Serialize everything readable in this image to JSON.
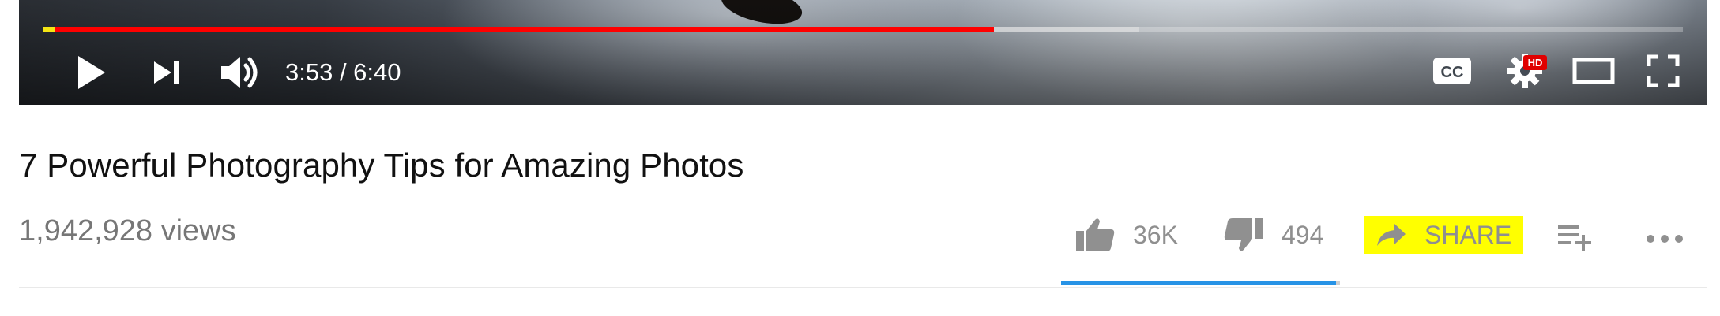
{
  "player": {
    "progress": {
      "played_fraction": 0.58,
      "buffered_fraction": 0.668
    },
    "time_display": "3:53 / 6:40",
    "settings_badge": "HD",
    "icons": {
      "play": "play-icon",
      "next": "skip-next-icon",
      "volume": "volume-icon",
      "captions": "closed-captions-icon",
      "settings": "gear-icon",
      "theater": "theater-mode-icon",
      "fullscreen": "fullscreen-icon"
    },
    "colors": {
      "played": "#ff0000",
      "chapter_marker": "#f4e514"
    }
  },
  "video": {
    "title": "7 Powerful Photography Tips for Amazing Photos",
    "views": "1,942,928 views"
  },
  "actions": {
    "likes": "36K",
    "dislikes": "494",
    "share": "SHARE",
    "icons": {
      "like": "thumbs-up-icon",
      "dislike": "thumbs-down-icon",
      "share": "share-arrow-icon",
      "add_to": "add-to-playlist-icon",
      "more": "more-horizontal-icon"
    },
    "sentiment_like_fraction": 0.986,
    "colors": {
      "share_highlight": "#ffff00",
      "sentiment_like": "#2793e6"
    }
  }
}
